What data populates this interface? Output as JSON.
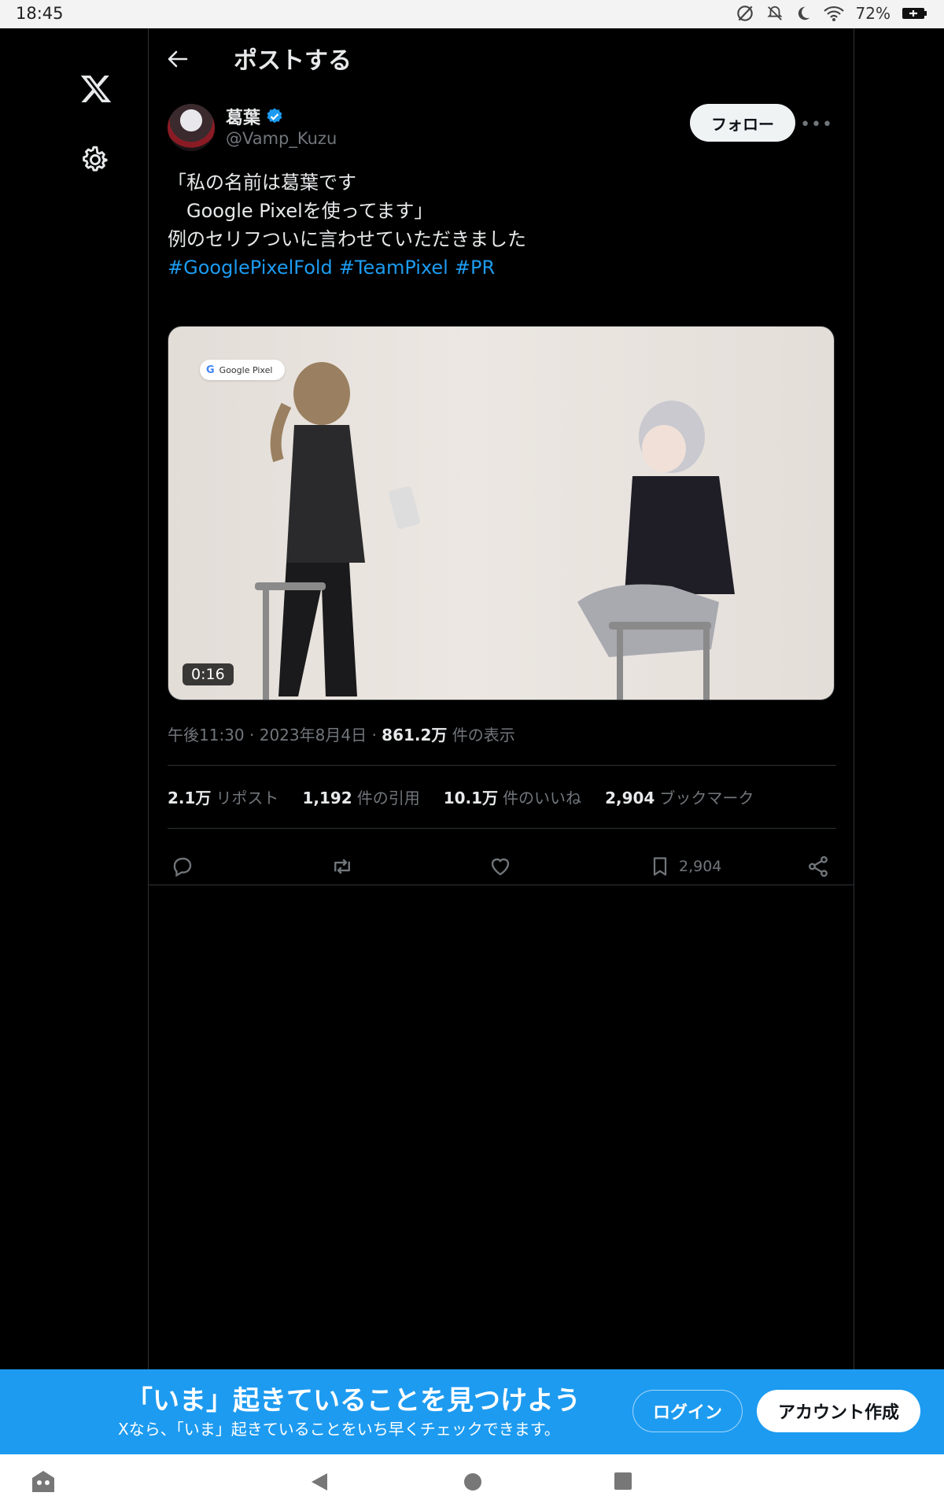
{
  "status_bar": {
    "time": "18:45",
    "battery": "72%"
  },
  "header": {
    "title": "ポストする"
  },
  "post": {
    "author": {
      "name": "葛葉",
      "handle": "@Vamp_Kuzu"
    },
    "follow_label": "フォロー",
    "text_lines": [
      "「私の名前は葛葉です",
      "　Google Pixelを使ってます」",
      "",
      "例のセリフついに言わせていただきました"
    ],
    "hashtags": [
      "#GooglePixelFold",
      "#TeamPixel",
      "#PR"
    ],
    "media": {
      "brand_chip": "Google Pixel",
      "brand_g": "G",
      "duration": "0:16"
    },
    "meta": {
      "time": "午後11:30",
      "date": "2023年8月4日",
      "views_count": "861.2万",
      "views_label": "件の表示",
      "separator": "·"
    },
    "stats": [
      {
        "count": "2.1万",
        "label": "リポスト"
      },
      {
        "count": "1,192",
        "label": "件の引用"
      },
      {
        "count": "10.1万",
        "label": "件のいいね"
      },
      {
        "count": "2,904",
        "label": "ブックマーク"
      }
    ],
    "bookmark_count": "2,904"
  },
  "cta": {
    "title": "「いま」起きていることを見つけよう",
    "subtitle": "Xなら、「いま」起きていることをいち早くチェックできます。",
    "login_label": "ログイン",
    "signup_label": "アカウント作成"
  },
  "colors": {
    "accent": "#1d9bf0",
    "background": "#000000",
    "muted": "#71767b"
  }
}
